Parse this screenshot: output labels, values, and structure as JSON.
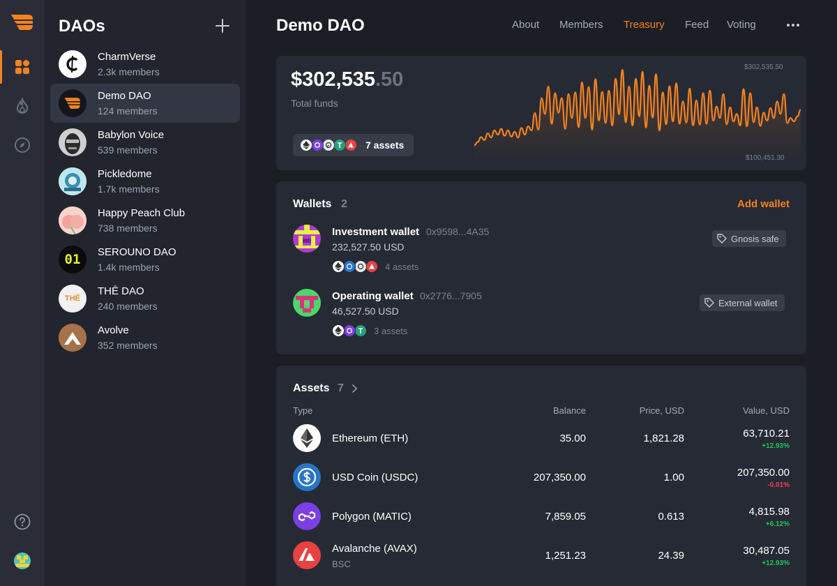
{
  "sidebar": {
    "title": "DAOs",
    "daos": [
      {
        "name": "CharmVerse",
        "members": "2.3k members"
      },
      {
        "name": "Demo DAO",
        "members": "124 members"
      },
      {
        "name": "Babylon Voice",
        "members": "539 members"
      },
      {
        "name": "Pickledome",
        "members": "1.7k members"
      },
      {
        "name": "Happy Peach Club",
        "members": "738 members"
      },
      {
        "name": "SEROUNO DAO",
        "members": "1.4k members"
      },
      {
        "name": "THĒ DAO",
        "members": "240 members"
      },
      {
        "name": "Avolve",
        "members": "352 members"
      }
    ],
    "logo_text": {
      "serouno": "01",
      "the": "THĒ"
    }
  },
  "header": {
    "title": "Demo DAO",
    "tabs": [
      "About",
      "Members",
      "Treasury",
      "Feed",
      "Voting"
    ],
    "active_tab": "Treasury"
  },
  "treasury": {
    "total_int": "$302,535",
    "total_dec": ".50",
    "total_label": "Total funds",
    "assets_label": "7 assets",
    "chart_max_label": "$302,535.50",
    "chart_min_label": "$100,451.30"
  },
  "chart_data": {
    "type": "area",
    "y_max": 302535.5,
    "y_min": 100451.3,
    "values": [
      120000,
      128000,
      140000,
      133000,
      149000,
      139000,
      156000,
      146000,
      160000,
      143000,
      156000,
      141000,
      153000,
      139000,
      162000,
      146000,
      166000,
      156000,
      198000,
      158000,
      234000,
      196000,
      262000,
      172000,
      246000,
      199000,
      234000,
      160000,
      244000,
      186000,
      248000,
      164000,
      272000,
      186000,
      261000,
      158000,
      280000,
      180000,
      249000,
      174000,
      252000,
      168000,
      281000,
      195000,
      302535,
      176000,
      262000,
      168000,
      281000,
      190000,
      298000,
      163000,
      264000,
      187000,
      292000,
      156000,
      248000,
      171000,
      263000,
      178000,
      270000,
      172000,
      226000,
      175000,
      257000,
      168000,
      229000,
      170000,
      246000,
      172000,
      252000,
      180000,
      214000,
      186000,
      244000,
      171000,
      212000,
      178000,
      196000,
      168000,
      256000,
      166000,
      246000,
      176000,
      212000,
      167000,
      199000,
      180000,
      210000,
      186000,
      226000,
      196000,
      244000,
      174000,
      186000,
      178000,
      190000,
      206000
    ]
  },
  "wallets": {
    "title": "Wallets",
    "count": "2",
    "add_label": "Add wallet",
    "items": [
      {
        "name": "Investment wallet",
        "address": "0x9598...4A35",
        "balance": "232,527.50 USD",
        "assets": "4 assets",
        "tag": "Gnosis safe"
      },
      {
        "name": "Operating wallet",
        "address": "0x2776...7905",
        "balance": "46,527.50 USD",
        "assets": "3 assets",
        "tag": "External wallet"
      }
    ]
  },
  "assets": {
    "title": "Assets",
    "count": "7",
    "columns": [
      "Type",
      "Balance",
      "Price, USD",
      "Value, USD"
    ],
    "rows": [
      {
        "name": "Ethereum (ETH)",
        "sub": "",
        "balance": "35.00",
        "price": "1,821.28",
        "value": "63,710.21",
        "change": "+12.93%",
        "icon": "ethereum-icon",
        "color": "#ffffff"
      },
      {
        "name": "USD Coin (USDC)",
        "sub": "",
        "balance": "207,350.00",
        "price": "1.00",
        "value": "207,350.00",
        "change": "-0.01%",
        "icon": "usdc-icon",
        "color": "#2775ca"
      },
      {
        "name": "Polygon (MATIC)",
        "sub": "",
        "balance": "7,859.05",
        "price": "0.613",
        "value": "4,815.98",
        "change": "+6.12%",
        "icon": "polygon-icon",
        "color": "#7b3fe4"
      },
      {
        "name": "Avalanche (AVAX)",
        "sub": "BSC",
        "balance": "1,251.23",
        "price": "24.39",
        "value": "30,487.05",
        "change": "+12.93%",
        "icon": "avalanche-icon",
        "color": "#e84142"
      }
    ]
  },
  "colors": {
    "accent": "#f5821f",
    "positive": "#22c55e",
    "negative": "#f43f5e"
  }
}
